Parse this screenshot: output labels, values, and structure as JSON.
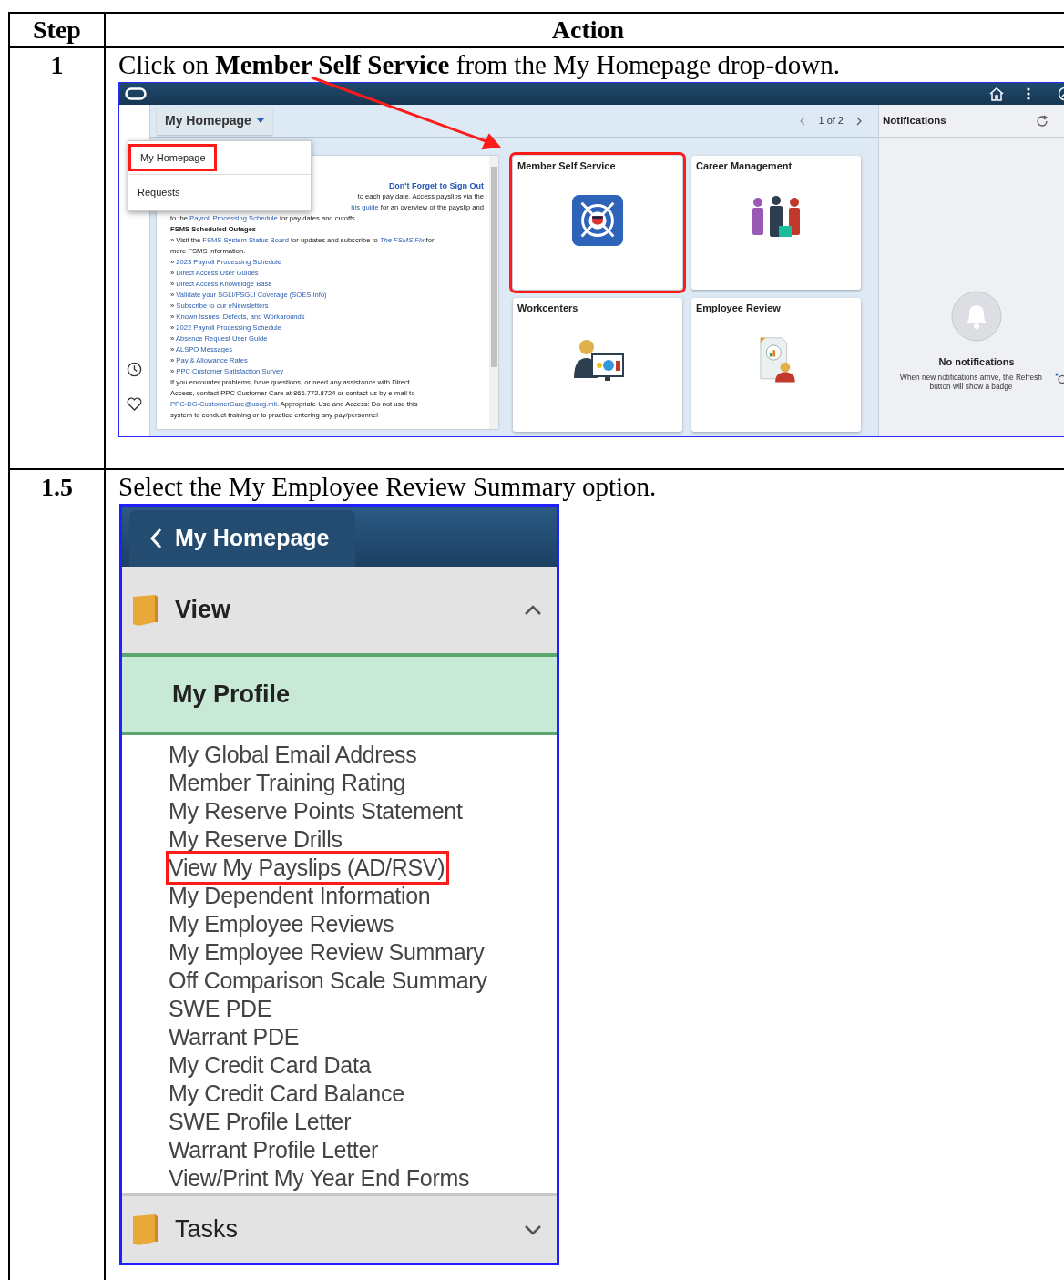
{
  "table": {
    "columns": [
      "Step",
      "Action"
    ]
  },
  "steps": [
    {
      "step": "1",
      "instruction": "Click on **Member Self Service** from the My Homepage drop-down.",
      "screenshot": {
        "kind": "homepage",
        "homepage_button": "My Homepage",
        "dropdown": [
          {
            "label": "My Homepage",
            "highlighted": true
          },
          {
            "label": "Requests",
            "highlighted": false
          }
        ],
        "pager": "1 of 2",
        "notice": {
          "title": "Don't Forget to Sign Out",
          "lines": [
            {
              "hidden_start": true,
              "bold": false,
              "segments": [
                {
                  "text": "to each pay date.  Access payslips via the",
                  "link": false
                }
              ]
            },
            {
              "hidden_start": true,
              "bold": false,
              "segments": [
                {
                  "text": "his guide",
                  "link": true
                },
                {
                  "text": " for an overview of the payslip and",
                  "link": false
                }
              ]
            },
            {
              "hidden_start": false,
              "bold": false,
              "segments": [
                {
                  "text": "to the ",
                  "link": false
                },
                {
                  "text": "Payroll Processing Schedule",
                  "link": true
                },
                {
                  "text": " for pay dates and cutoffs.",
                  "link": false
                }
              ]
            },
            {
              "hidden_start": false,
              "bold": true,
              "segments": [
                {
                  "text": "FSMS Scheduled Outages",
                  "link": false
                }
              ]
            },
            {
              "hidden_start": false,
              "bold": false,
              "segments": [
                {
                  "text": "» Visit the ",
                  "link": false
                },
                {
                  "text": "FSMS System Status Board",
                  "link": true
                },
                {
                  "text": " for updates and subscribe to ",
                  "link": false
                },
                {
                  "text": "*The FSMS Fix*",
                  "link": true
                },
                {
                  "text": " for",
                  "link": false
                }
              ]
            },
            {
              "hidden_start": false,
              "bold": false,
              "segments": [
                {
                  "text": "more FSMS information.",
                  "link": false
                }
              ]
            },
            {
              "hidden_start": false,
              "bold": false,
              "segments": [
                {
                  "text": "» ",
                  "link": false
                },
                {
                  "text": "2023 Payroll Processing Schedule",
                  "link": true
                }
              ]
            },
            {
              "hidden_start": false,
              "bold": false,
              "segments": [
                {
                  "text": "» ",
                  "link": false
                },
                {
                  "text": "Direct Access User Guides",
                  "link": true
                }
              ]
            },
            {
              "hidden_start": false,
              "bold": false,
              "segments": [
                {
                  "text": "» ",
                  "link": false
                },
                {
                  "text": "Direct Access Knoweldge Base",
                  "link": true
                }
              ]
            },
            {
              "hidden_start": false,
              "bold": false,
              "segments": [
                {
                  "text": "» ",
                  "link": false
                },
                {
                  "text": "Validate your SGLI/FSGLI Coverage (SOES Info)",
                  "link": true
                }
              ]
            },
            {
              "hidden_start": false,
              "bold": false,
              "segments": [
                {
                  "text": "» ",
                  "link": false
                },
                {
                  "text": "Subscribe to our eNewsletters",
                  "link": true
                }
              ]
            },
            {
              "hidden_start": false,
              "bold": false,
              "segments": [
                {
                  "text": "» ",
                  "link": false
                },
                {
                  "text": "Known Issues, Defects, and Workarounds",
                  "link": true
                }
              ]
            },
            {
              "hidden_start": false,
              "bold": false,
              "segments": [
                {
                  "text": "» ",
                  "link": false
                },
                {
                  "text": "2022 Payroll Processing Schedule",
                  "link": true
                }
              ]
            },
            {
              "hidden_start": false,
              "bold": false,
              "segments": [
                {
                  "text": "» ",
                  "link": false
                },
                {
                  "text": "Absence Request User Guide",
                  "link": true
                }
              ]
            },
            {
              "hidden_start": false,
              "bold": false,
              "segments": [
                {
                  "text": "» ",
                  "link": false
                },
                {
                  "text": "ALSPO Messages",
                  "link": true
                }
              ]
            },
            {
              "hidden_start": false,
              "bold": false,
              "segments": [
                {
                  "text": "» ",
                  "link": false
                },
                {
                  "text": "Pay & Allowance Rates",
                  "link": true
                }
              ]
            },
            {
              "hidden_start": false,
              "bold": false,
              "segments": [
                {
                  "text": "» ",
                  "link": false
                },
                {
                  "text": "PPC Customer Satisfaction Survey",
                  "link": true
                }
              ]
            },
            {
              "hidden_start": false,
              "bold": false,
              "segments": [
                {
                  "text": "If you encounter problems, have questions, or need any assistance with Direct",
                  "link": false
                }
              ]
            },
            {
              "hidden_start": false,
              "bold": false,
              "segments": [
                {
                  "text": "Access, contact PPC Customer Care at 866.772.8724 or contact us by e-mail to",
                  "link": false
                }
              ]
            },
            {
              "hidden_start": false,
              "bold": false,
              "segments": [
                {
                  "text": "PPC-DG-CustomerCare@uscg.mil",
                  "link": true
                },
                {
                  "text": ". Appropriate Use and Access: Do not use this",
                  "link": false
                }
              ]
            },
            {
              "hidden_start": false,
              "bold": false,
              "segments": [
                {
                  "text": "system to conduct training or to practice entering any pay/personnel",
                  "link": false
                }
              ]
            }
          ]
        },
        "tiles": [
          {
            "title": "Member Self Service",
            "kind": "emblem",
            "highlighted": true
          },
          {
            "title": "Career Management",
            "kind": "people",
            "highlighted": false
          },
          {
            "title": "Workcenters",
            "kind": "workcenter",
            "highlighted": false
          },
          {
            "title": "Employee Review",
            "kind": "review",
            "highlighted": false
          }
        ],
        "notifications": {
          "title": "Notifications",
          "empty_title": "No notifications",
          "empty_text": "When new notifications arrive, the Refresh button will show a badge"
        }
      }
    },
    {
      "step": "1.5",
      "instruction": "Select the My Employee Review Summary option.",
      "screenshot": {
        "kind": "menu",
        "back_button": "My Homepage",
        "sections": [
          {
            "label": "View",
            "expanded": true
          },
          {
            "label": "Tasks",
            "expanded": false
          }
        ],
        "group": "My Profile",
        "items": [
          {
            "label": "My Global Email Address",
            "highlighted": false
          },
          {
            "label": "Member Training Rating",
            "highlighted": false
          },
          {
            "label": "My Reserve Points Statement",
            "highlighted": false
          },
          {
            "label": "My Reserve Drills",
            "highlighted": false
          },
          {
            "label": "View My Payslips (AD/RSV)",
            "highlighted": true
          },
          {
            "label": "My Dependent Information",
            "highlighted": false
          },
          {
            "label": "My Employee Reviews",
            "highlighted": false
          },
          {
            "label": "My Employee Review Summary",
            "highlighted": false
          },
          {
            "label": "Off Comparison Scale Summary",
            "highlighted": false
          },
          {
            "label": "SWE PDE",
            "highlighted": false
          },
          {
            "label": "Warrant PDE",
            "highlighted": false
          },
          {
            "label": "My Credit Card Data",
            "highlighted": false
          },
          {
            "label": "My Credit Card Balance",
            "highlighted": false
          },
          {
            "label": "SWE Profile Letter",
            "highlighted": false
          },
          {
            "label": "Warrant Profile Letter",
            "highlighted": false
          },
          {
            "label": "View/Print My Year End Forms",
            "highlighted": false
          }
        ]
      }
    }
  ]
}
